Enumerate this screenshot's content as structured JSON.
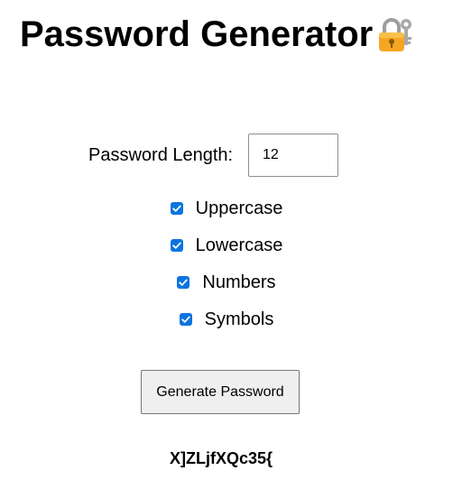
{
  "page": {
    "title": "Password Generator",
    "title_icon": "locked-with-key-icon"
  },
  "length": {
    "label": "Password Length:",
    "value": "12"
  },
  "options": [
    {
      "label": "Uppercase",
      "checked": true
    },
    {
      "label": "Lowercase",
      "checked": true
    },
    {
      "label": "Numbers",
      "checked": true
    },
    {
      "label": "Symbols",
      "checked": true
    }
  ],
  "generate_button": {
    "label": "Generate Password"
  },
  "output": {
    "password": "X]ZLjfXQc35{"
  },
  "colors": {
    "checkbox_accent": "#0b74de",
    "button_bg": "#efefef",
    "lock_body": "#f5b041",
    "key": "#b0b0b0"
  }
}
